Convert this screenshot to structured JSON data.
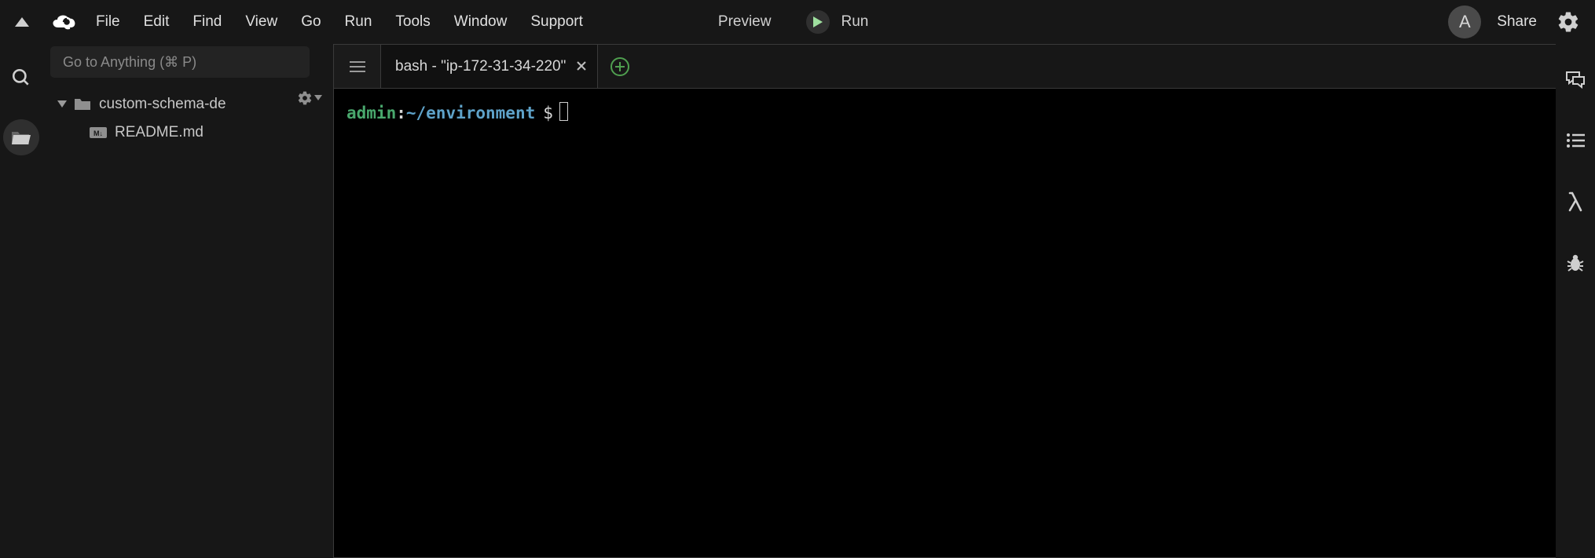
{
  "menu": {
    "items": [
      "File",
      "Edit",
      "Find",
      "View",
      "Go",
      "Run",
      "Tools",
      "Window",
      "Support"
    ]
  },
  "top": {
    "preview": "Preview",
    "run": "Run",
    "share": "Share",
    "avatar_initial": "A"
  },
  "search": {
    "placeholder": "Go to Anything (⌘ P)"
  },
  "tree": {
    "root": "custom-schema-de",
    "children": [
      {
        "name": "README.md",
        "type": "md"
      }
    ]
  },
  "tabs": [
    {
      "label": "bash - \"ip-172-31-34-220\""
    }
  ],
  "terminal": {
    "user": "admin",
    "colon": ":",
    "path": "~/environment",
    "prompt": "$"
  }
}
